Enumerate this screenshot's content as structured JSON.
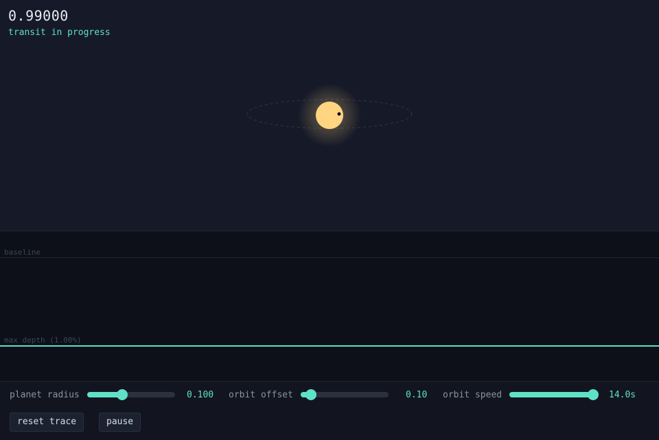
{
  "readout": {
    "flux": "0.99000",
    "status": "transit in progress"
  },
  "lightcurve": {
    "baseline_label": "baseline",
    "depth_label": "max depth (1.00%)"
  },
  "controls": {
    "planet_radius": {
      "label": "planet radius",
      "value": "0.100",
      "level": 0.4
    },
    "orbit_offset": {
      "label": "orbit offset",
      "value": "0.10",
      "level": 0.12
    },
    "orbit_speed": {
      "label": "orbit speed",
      "value": "14.0s",
      "level": 0.95
    },
    "reset_label": "reset trace",
    "pause_label": "pause"
  },
  "colors": {
    "accent": "#5fe0c8",
    "star": "#ffd582",
    "background": "#161a28"
  }
}
